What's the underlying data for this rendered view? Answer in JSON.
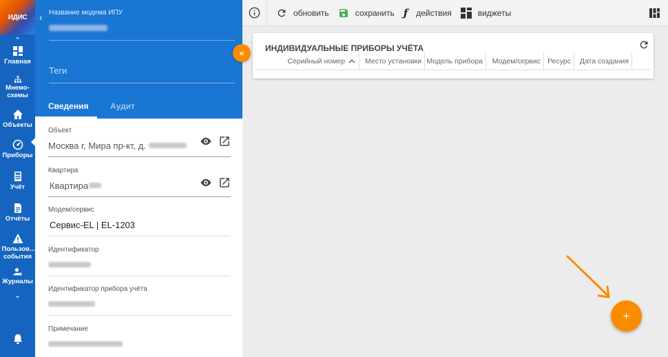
{
  "app": {
    "logo_text": "ИДИС"
  },
  "rail": {
    "items": [
      {
        "label": "Главная",
        "icon": "dashboard-icon"
      },
      {
        "label": "Мнемо-схемы",
        "icon": "sitemap-icon"
      },
      {
        "label": "Объекты",
        "icon": "home-icon"
      },
      {
        "label": "Приборы",
        "icon": "gauge-icon",
        "active": true
      },
      {
        "label": "Учёт",
        "icon": "calculator-icon"
      },
      {
        "label": "Отчёты",
        "icon": "document-icon"
      },
      {
        "label": "Пользов... события",
        "icon": "warning-icon"
      },
      {
        "label": "Журналы",
        "icon": "user-gear-icon"
      }
    ]
  },
  "panel": {
    "modem_name_label": "Название модема ИПУ",
    "tags_label": "Теги",
    "tabs": [
      {
        "label": "Сведения",
        "active": true
      },
      {
        "label": "Аудит",
        "active": false
      }
    ],
    "fields": {
      "object": {
        "label": "Объект",
        "value": "Москва г, Мира пр-кт, д."
      },
      "apartment": {
        "label": "Квартира",
        "value": "Квартира"
      },
      "modem": {
        "label": "Модем/сервис",
        "value": "Сервис-EL | EL-1203"
      },
      "identifier": {
        "label": "Идентификатор"
      },
      "meter_identifier": {
        "label": "Идентификатор прибора учёта"
      },
      "note": {
        "label": "Примечание"
      }
    }
  },
  "toolbar": {
    "refresh": "обновить",
    "save": "сохранить",
    "actions": "действия",
    "widgets": "виджеты",
    "save_color": "#4caf50"
  },
  "card": {
    "title": "ИНДИВИДУАЛЬНЫЕ ПРИБОРЫ УЧЁТА",
    "columns": [
      "Серийный номер",
      "Место установки",
      "Модель прибора",
      "Модем/сервис",
      "Ресурс",
      "Дата создания"
    ]
  },
  "fab": {
    "label": "+"
  },
  "colors": {
    "accent": "#fb8c00",
    "rail": "#1565c0",
    "header": "#1976d2"
  }
}
